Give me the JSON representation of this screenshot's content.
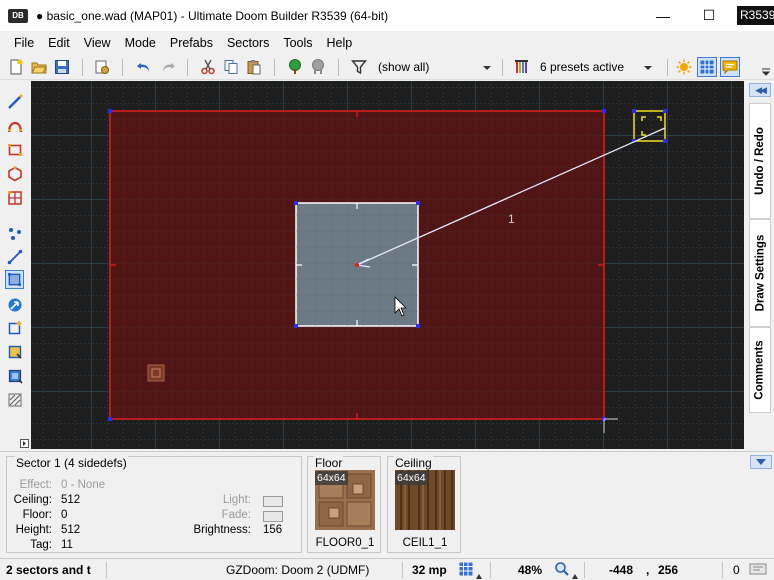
{
  "window": {
    "app_icon": "DB",
    "title": "● basic_one.wad (MAP01) - Ultimate Doom Builder R3539 (64-bit)",
    "minimize": "—",
    "maximize": "☐",
    "revision_badge": "R3539"
  },
  "menu": [
    "File",
    "Edit",
    "View",
    "Mode",
    "Prefabs",
    "Sectors",
    "Tools",
    "Help"
  ],
  "toolbar": {
    "filter_value": "(show all)",
    "presets_value": "6 presets active"
  },
  "canvas": {
    "line_length_label": "1",
    "colors": {
      "background": "#1e1e1e",
      "grid": "#2f4b57",
      "outer_sector_fill": "#5a1414",
      "outer_sector_line": "#e01e1e",
      "inner_sector_fill": "#6e7f8c",
      "vertex": "#2a2af0",
      "selection": "#f0e020"
    }
  },
  "dock_tabs": [
    "Undo / Redo",
    "Draw Settings",
    "Comments"
  ],
  "info": {
    "sector_title": "Sector 1 (4 sidedefs)",
    "effect_label": "Effect:",
    "effect_value": "0 - None",
    "ceiling_label": "Ceiling:",
    "ceiling_value": "512",
    "floor_label": "Floor:",
    "floor_value": "0",
    "height_label": "Height:",
    "height_value": "512",
    "tag_label": "Tag:",
    "tag_value": "11",
    "light_label": "Light:",
    "fade_label": "Fade:",
    "brightness_label": "Brightness:",
    "brightness_value": "156",
    "floor_box_title": "Floor",
    "floor_tex_size": "64x64",
    "floor_tex_name": "FLOOR0_1",
    "ceiling_box_title": "Ceiling",
    "ceiling_tex_size": "64x64",
    "ceiling_tex_name": "CEIL1_1"
  },
  "status": {
    "message": "2 sectors and t",
    "engine": "GZDoom: Doom 2 (UDMF)",
    "grid": "32 mp",
    "zoom": "48%",
    "coords_x": "-448",
    "coords_sep": ",",
    "coords_y": "256",
    "counter": "0"
  }
}
